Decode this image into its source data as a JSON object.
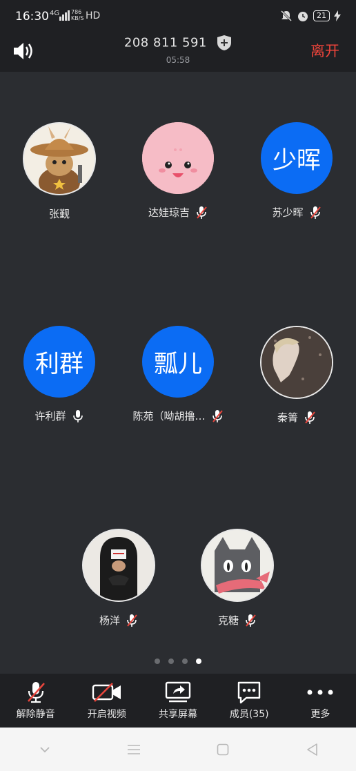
{
  "status_bar": {
    "time": "16:30",
    "network": "4G",
    "speed_value": "786",
    "speed_unit": "KB/S",
    "hd": "HD",
    "battery": "21"
  },
  "meeting": {
    "id": "208 811 591",
    "timer": "05:58",
    "leave_label": "离开"
  },
  "participants": [
    {
      "name": "张觐",
      "avatar_text": "",
      "muted": false,
      "show_mic": false
    },
    {
      "name": "达娃琼吉",
      "avatar_text": "",
      "muted": true,
      "show_mic": true
    },
    {
      "name": "苏少晖",
      "avatar_text": "少晖",
      "muted": true,
      "show_mic": true
    },
    {
      "name": "许利群",
      "avatar_text": "利群",
      "muted": false,
      "show_mic": true
    },
    {
      "name": "陈苑（呦胡撸…",
      "avatar_text": "瓢儿",
      "muted": true,
      "show_mic": true
    },
    {
      "name": "秦箐",
      "avatar_text": "",
      "muted": true,
      "show_mic": true
    },
    {
      "name": "杨洋",
      "avatar_text": "",
      "muted": true,
      "show_mic": true
    },
    {
      "name": "克糖",
      "avatar_text": "",
      "muted": true,
      "show_mic": true
    }
  ],
  "pagination": {
    "total": 4,
    "current": 4
  },
  "toolbar": {
    "unmute_label": "解除静音",
    "video_label": "开启视频",
    "share_label": "共享屏幕",
    "members_label": "成员(35)",
    "more_label": "更多"
  },
  "colors": {
    "accent_blue": "#0b6cf4",
    "leave_red": "#f0453b",
    "mute_red": "#e8453c"
  }
}
